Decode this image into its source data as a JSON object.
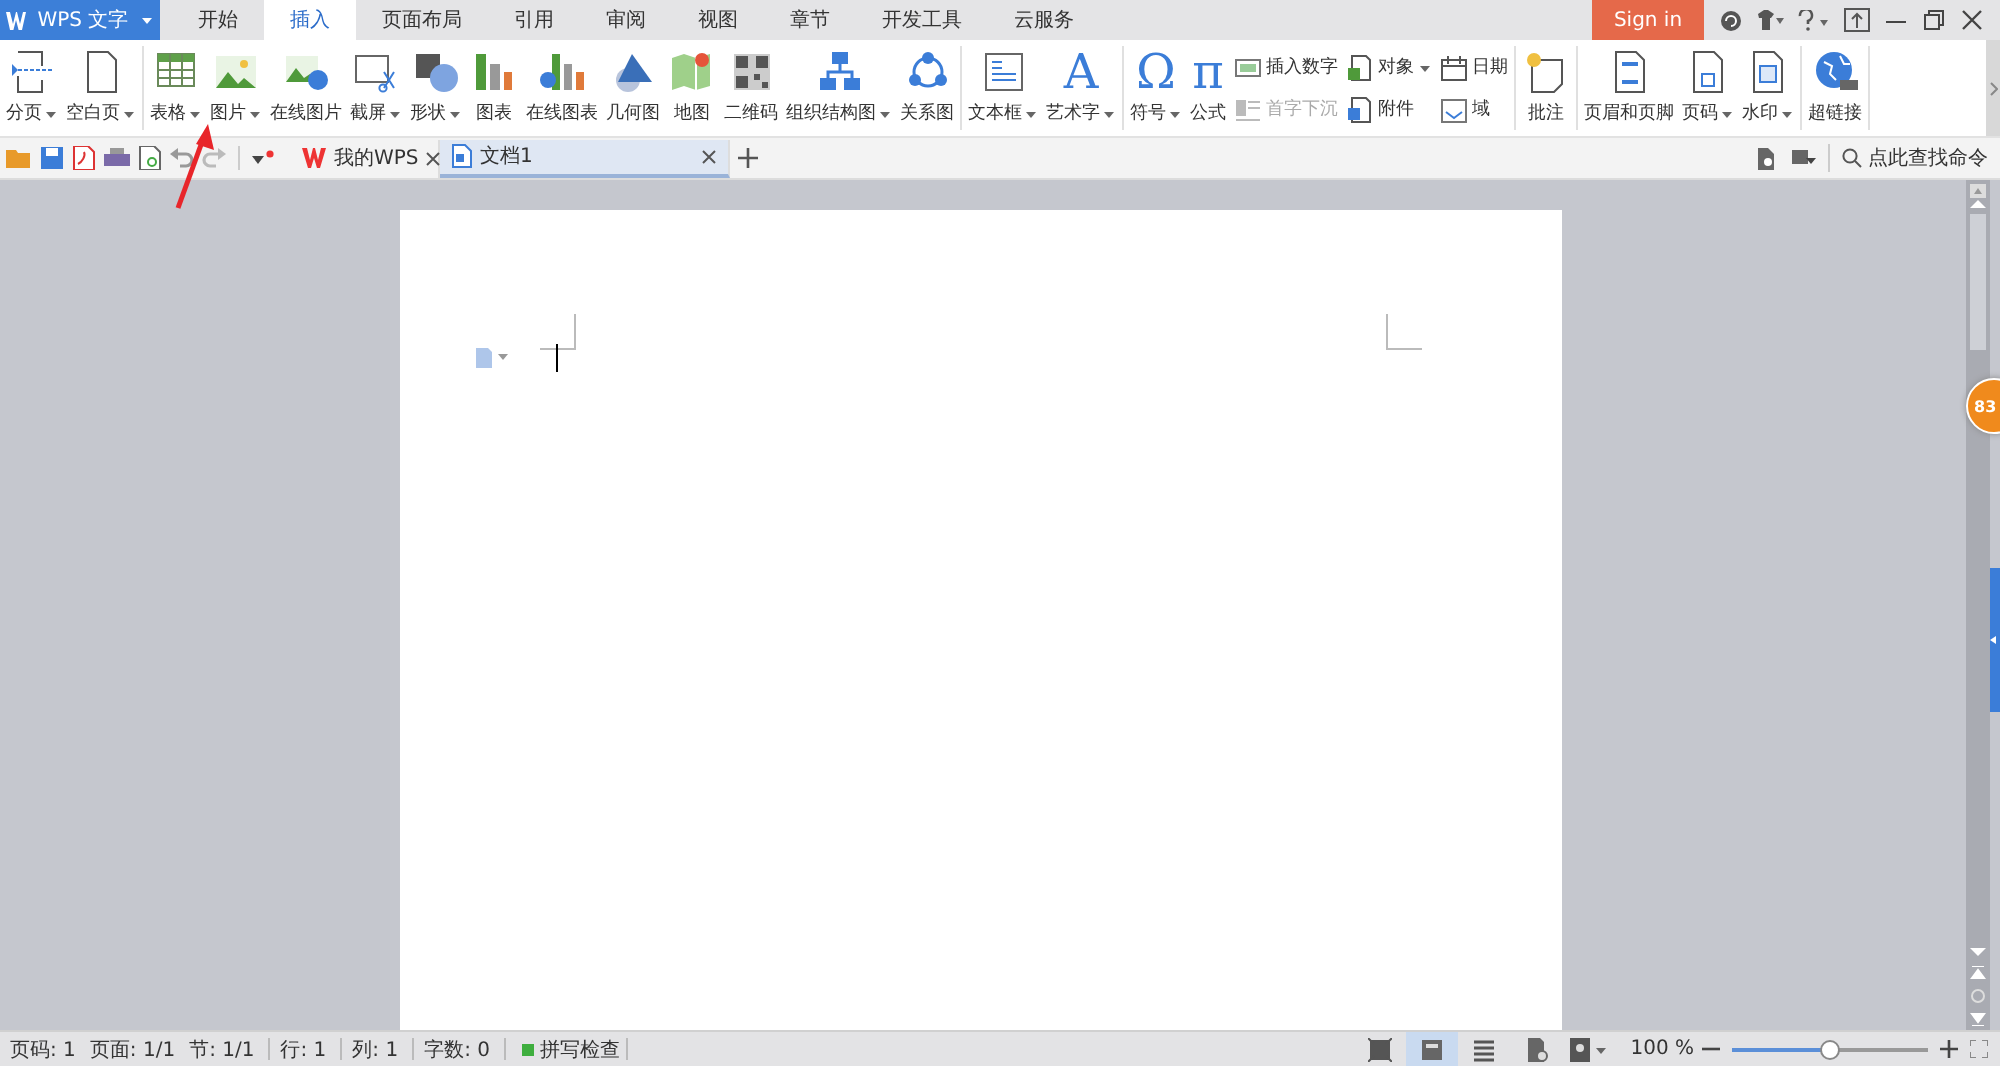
{
  "app_menu": {
    "label": "WPS 文字"
  },
  "tabs": [
    {
      "label": "开始",
      "selected": false
    },
    {
      "label": "插入",
      "selected": true
    },
    {
      "label": "页面布局",
      "selected": false
    },
    {
      "label": "引用",
      "selected": false
    },
    {
      "label": "审阅",
      "selected": false
    },
    {
      "label": "视图",
      "selected": false
    },
    {
      "label": "章节",
      "selected": false
    },
    {
      "label": "开发工具",
      "selected": false
    },
    {
      "label": "云服务",
      "selected": false
    }
  ],
  "sign_in": "Sign in",
  "ribbon": {
    "groups": [
      {
        "items": [
          {
            "kind": "large",
            "label": "分页",
            "dropdown": true,
            "disabled": false
          },
          {
            "kind": "large",
            "label": "空白页",
            "dropdown": true,
            "disabled": false
          }
        ]
      },
      {
        "items": [
          {
            "kind": "large",
            "label": "表格",
            "dropdown": true,
            "disabled": false
          },
          {
            "kind": "large",
            "label": "图片",
            "dropdown": true,
            "disabled": false
          },
          {
            "kind": "large",
            "label": "在线图片",
            "dropdown": false,
            "disabled": false
          },
          {
            "kind": "large",
            "label": "截屏",
            "dropdown": true,
            "disabled": false
          },
          {
            "kind": "large",
            "label": "形状",
            "dropdown": true,
            "disabled": false
          },
          {
            "kind": "large",
            "label": "图表",
            "dropdown": false,
            "disabled": false
          },
          {
            "kind": "large",
            "label": "在线图表",
            "dropdown": false,
            "disabled": false
          },
          {
            "kind": "large",
            "label": "几何图",
            "dropdown": false,
            "disabled": false
          },
          {
            "kind": "large",
            "label": "地图",
            "dropdown": false,
            "disabled": false
          },
          {
            "kind": "large",
            "label": "二维码",
            "dropdown": false,
            "disabled": false
          },
          {
            "kind": "large",
            "label": "组织结构图",
            "dropdown": true,
            "disabled": false
          },
          {
            "kind": "large",
            "label": "关系图",
            "dropdown": false,
            "disabled": false
          }
        ]
      },
      {
        "items": [
          {
            "kind": "large",
            "label": "文本框",
            "dropdown": true,
            "disabled": false
          },
          {
            "kind": "glyph",
            "glyph": "A",
            "label": "艺术字",
            "dropdown": true,
            "disabled": false
          }
        ]
      },
      {
        "items": [
          {
            "kind": "glyph",
            "glyph": "Ω",
            "label": "符号",
            "dropdown": true,
            "disabled": false
          },
          {
            "kind": "glyph",
            "glyph": "π",
            "label": "公式",
            "dropdown": false,
            "disabled": false
          },
          {
            "kind": "column",
            "items": [
              {
                "label": "插入数字",
                "dropdown": false,
                "disabled": false
              },
              {
                "label": "首字下沉",
                "dropdown": false,
                "disabled": true
              }
            ]
          },
          {
            "kind": "column",
            "items": [
              {
                "label": "对象",
                "dropdown": true,
                "disabled": false
              },
              {
                "label": "附件",
                "dropdown": false,
                "disabled": false
              }
            ]
          },
          {
            "kind": "column",
            "items": [
              {
                "label": "日期",
                "dropdown": false,
                "disabled": false
              },
              {
                "label": "域",
                "dropdown": false,
                "disabled": false
              }
            ]
          }
        ]
      },
      {
        "items": [
          {
            "kind": "large",
            "label": "批注",
            "dropdown": false,
            "disabled": false
          }
        ]
      },
      {
        "items": [
          {
            "kind": "large",
            "label": "页眉和页脚",
            "dropdown": false,
            "disabled": false
          },
          {
            "kind": "large",
            "label": "页码",
            "dropdown": true,
            "disabled": false
          },
          {
            "kind": "large",
            "label": "水印",
            "dropdown": true,
            "disabled": false
          }
        ]
      },
      {
        "items": [
          {
            "kind": "large",
            "label": "超链接",
            "dropdown": false,
            "disabled": false
          }
        ]
      }
    ]
  },
  "doc_tabs": [
    {
      "label": "我的WPS",
      "selected": false
    },
    {
      "label": "文档1",
      "selected": true
    }
  ],
  "command_search": {
    "placeholder": "点此查找命令"
  },
  "badge": "83",
  "status_bar": {
    "items": [
      "页码: 1",
      "页面: 1/1",
      "节: 1/1",
      "行: 1",
      "列: 1",
      "字数: 0"
    ],
    "spell_check": "拼写检查",
    "views": [
      {
        "selected": false
      },
      {
        "selected": true
      },
      {
        "selected": false
      },
      {
        "selected": false
      },
      {
        "selected": false
      }
    ],
    "zoom": {
      "text": "100 %",
      "level": 0.5
    }
  },
  "annotations": [
    {
      "kind": "arrow"
    }
  ]
}
